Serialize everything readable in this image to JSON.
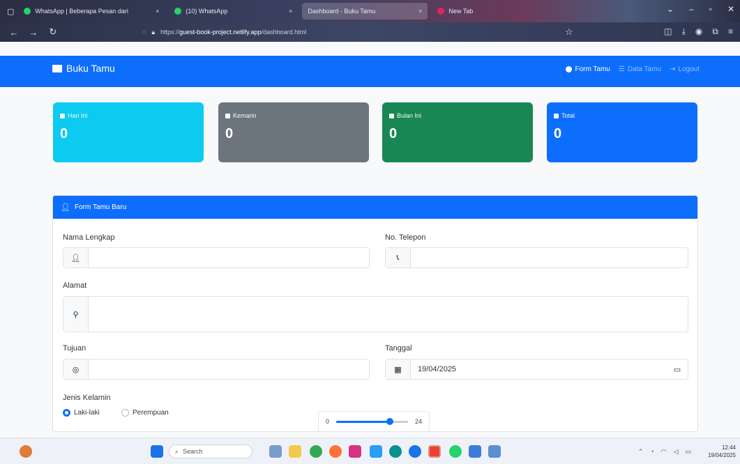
{
  "browser": {
    "tabs": [
      {
        "title": "WhatsApp | Beberapa Pesan dari",
        "color": "#25d366",
        "active": false
      },
      {
        "title": "(10) WhatsApp",
        "color": "#25d366",
        "active": false
      },
      {
        "title": "Dashboard - Buku Tamu",
        "color": "#0d6efd",
        "active": true
      },
      {
        "title": "New Tab",
        "color": "#e0245e",
        "active": false
      }
    ],
    "url_prefix": "https://",
    "url_domain": "guest-book-project.netlify.app",
    "url_path": "/dashboard.html"
  },
  "app": {
    "brand": "Buku Tamu",
    "nav": [
      {
        "label": "Form Tamu",
        "active": true
      },
      {
        "label": "Data Tamu",
        "active": false
      },
      {
        "label": "Logout",
        "active": false
      }
    ]
  },
  "stats": [
    {
      "label": "Hari Ini",
      "value": "0",
      "color": "#0dcaf0"
    },
    {
      "label": "Kemarin",
      "value": "0",
      "color": "#6c757d"
    },
    {
      "label": "Bulan Ini",
      "value": "0",
      "color": "#198754"
    },
    {
      "label": "Total",
      "value": "0",
      "color": "#0d6efd"
    }
  ],
  "form": {
    "title": "Form Tamu Baru",
    "nama_label": "Nama Lengkap",
    "telepon_label": "No. Telepon",
    "alamat_label": "Alamat",
    "tujuan_label": "Tujuan",
    "tanggal_label": "Tanggal",
    "tanggal_value": "19/04/2025",
    "jk_label": "Jenis Kelamin",
    "jk_options": [
      "Laki-laki",
      "Perempuan"
    ],
    "jk_selected": "Laki-laki"
  },
  "volume_popup": {
    "min_label": "0",
    "max_label": "24",
    "level_fraction": 0.75
  },
  "taskbar": {
    "search_placeholder": "Search",
    "time": "12:44",
    "date": "19/04/2025"
  }
}
